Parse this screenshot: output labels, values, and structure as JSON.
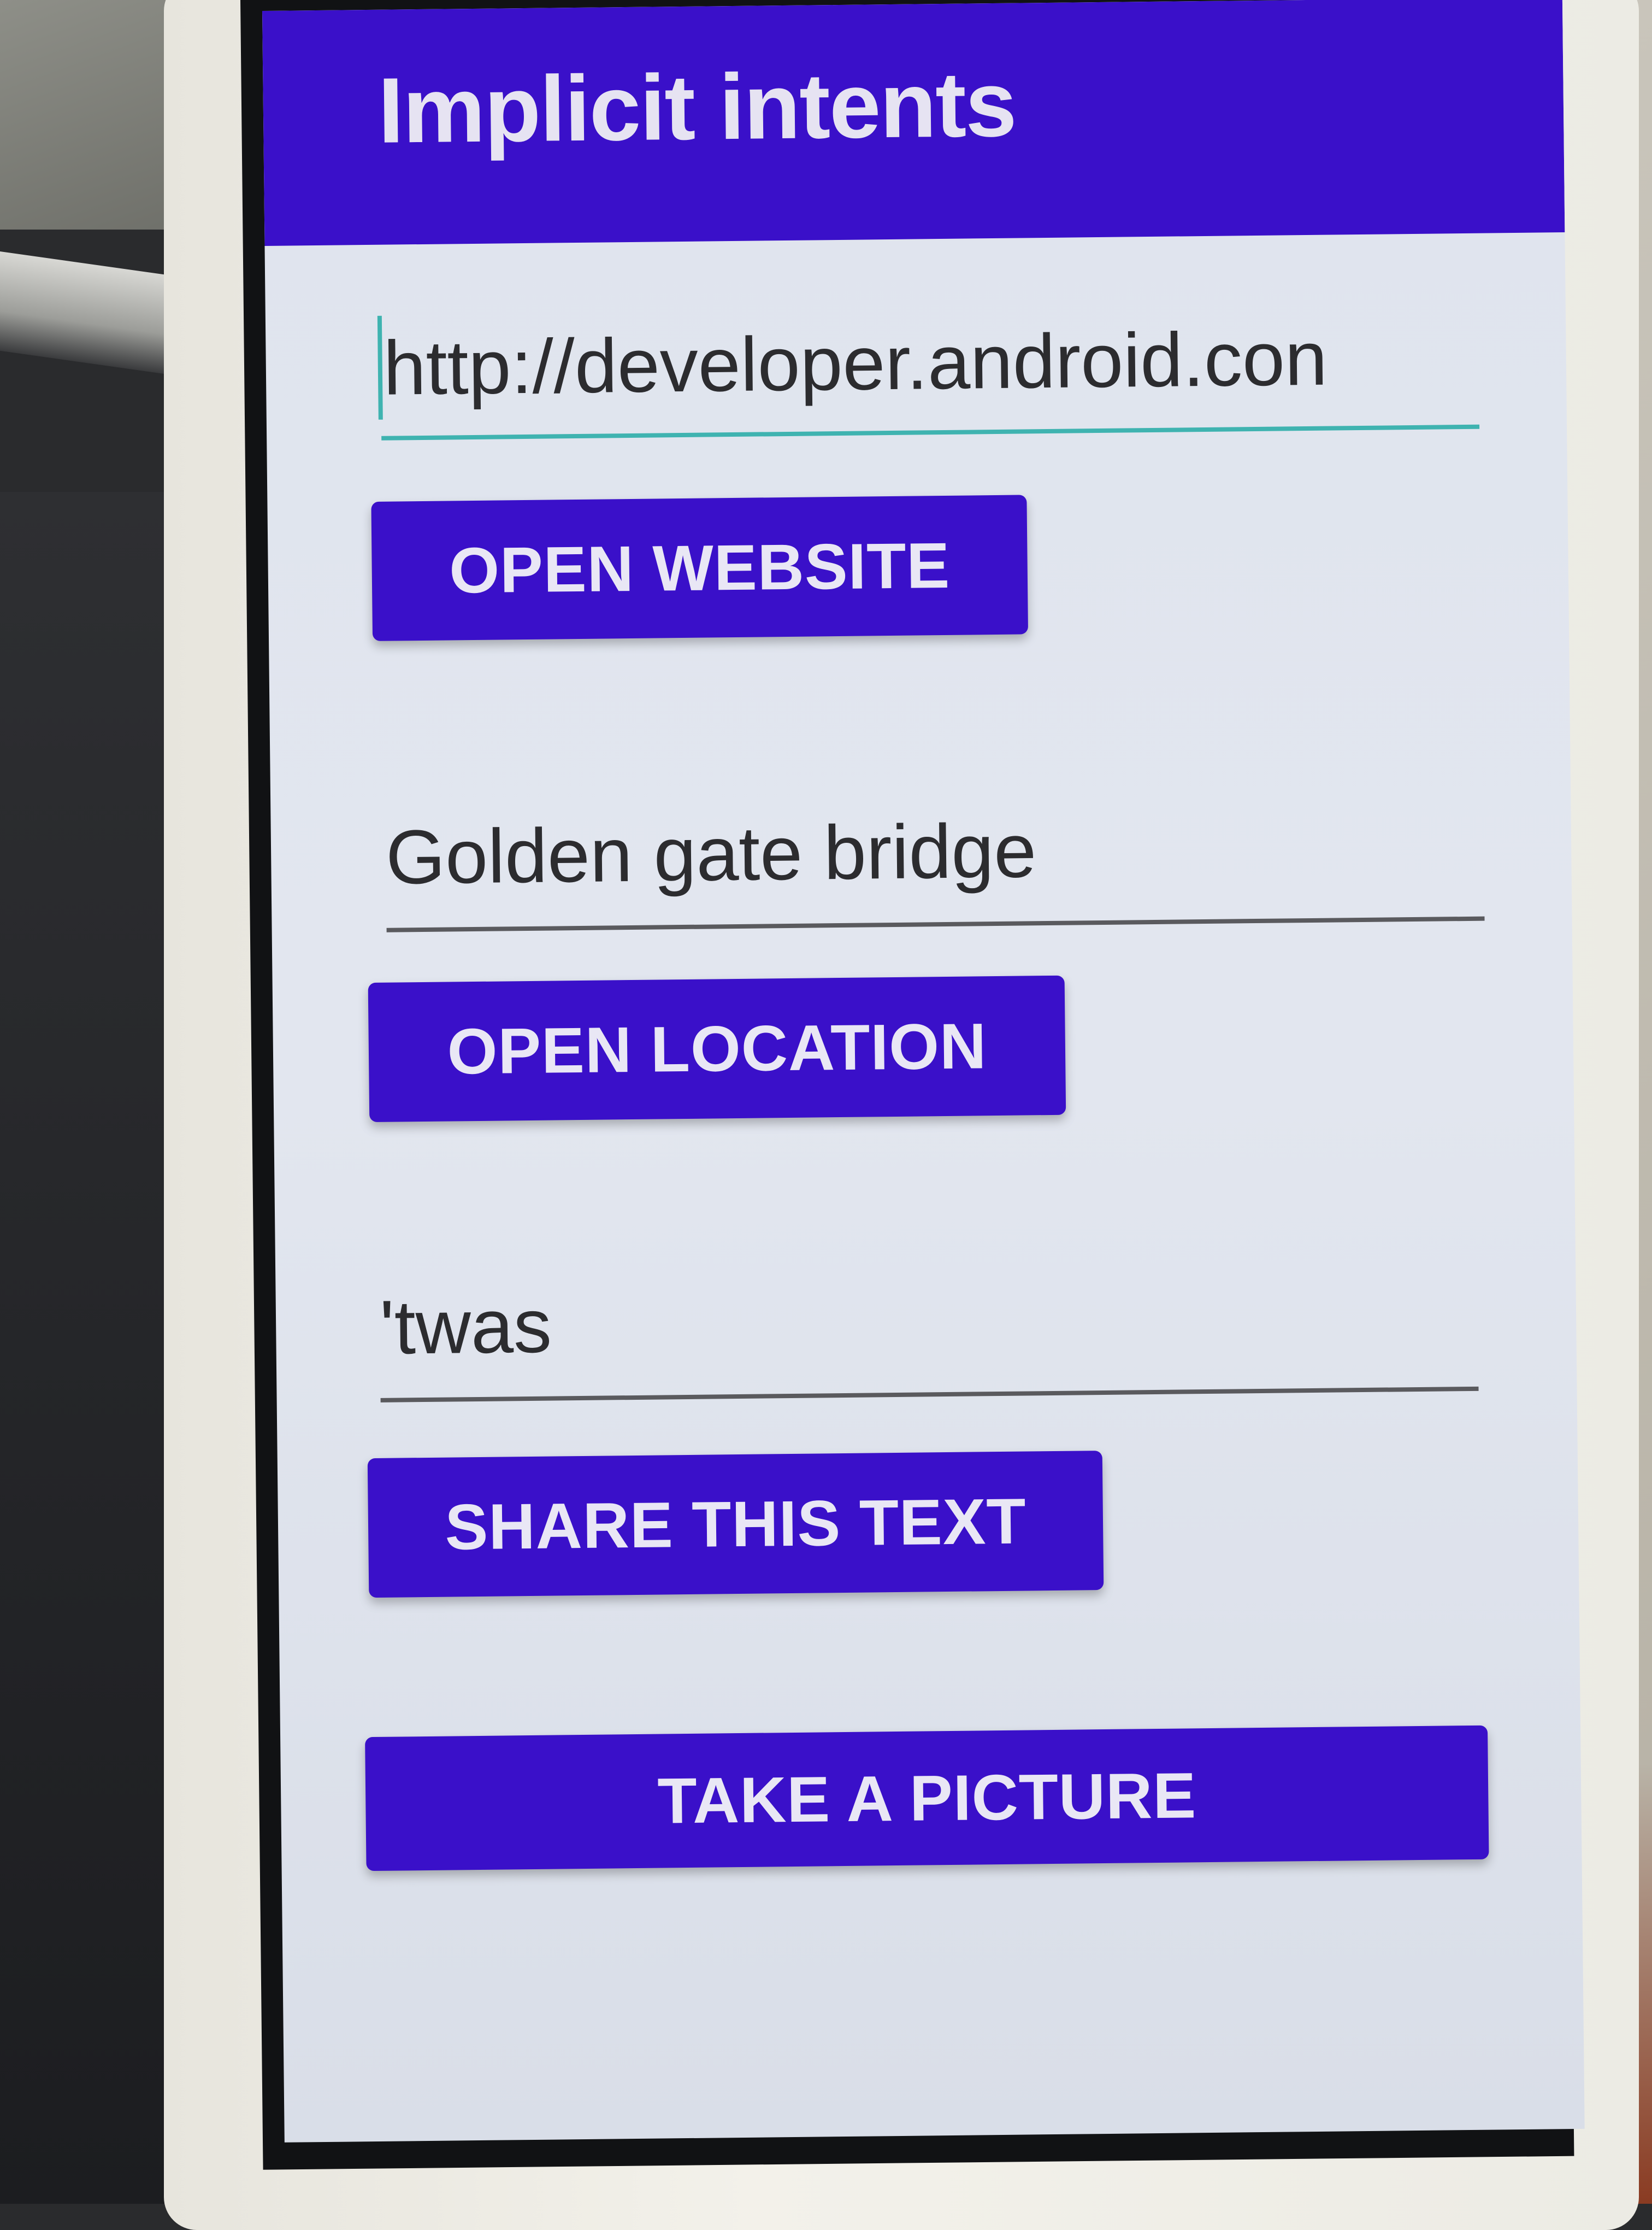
{
  "app_bar": {
    "title": "Implicit intents"
  },
  "website": {
    "input_value": "http://developer.android.con",
    "button_label": "OPEN WEBSITE"
  },
  "location": {
    "input_value": "Golden gate bridge",
    "button_label": "OPEN LOCATION"
  },
  "share": {
    "input_value": "'twas",
    "button_label": "SHARE THIS TEXT"
  },
  "camera": {
    "button_label": "TAKE A PICTURE"
  },
  "colors": {
    "primary": "#3a10c9",
    "accent": "#3fb3b0",
    "button_text": "#e9e7f5"
  }
}
